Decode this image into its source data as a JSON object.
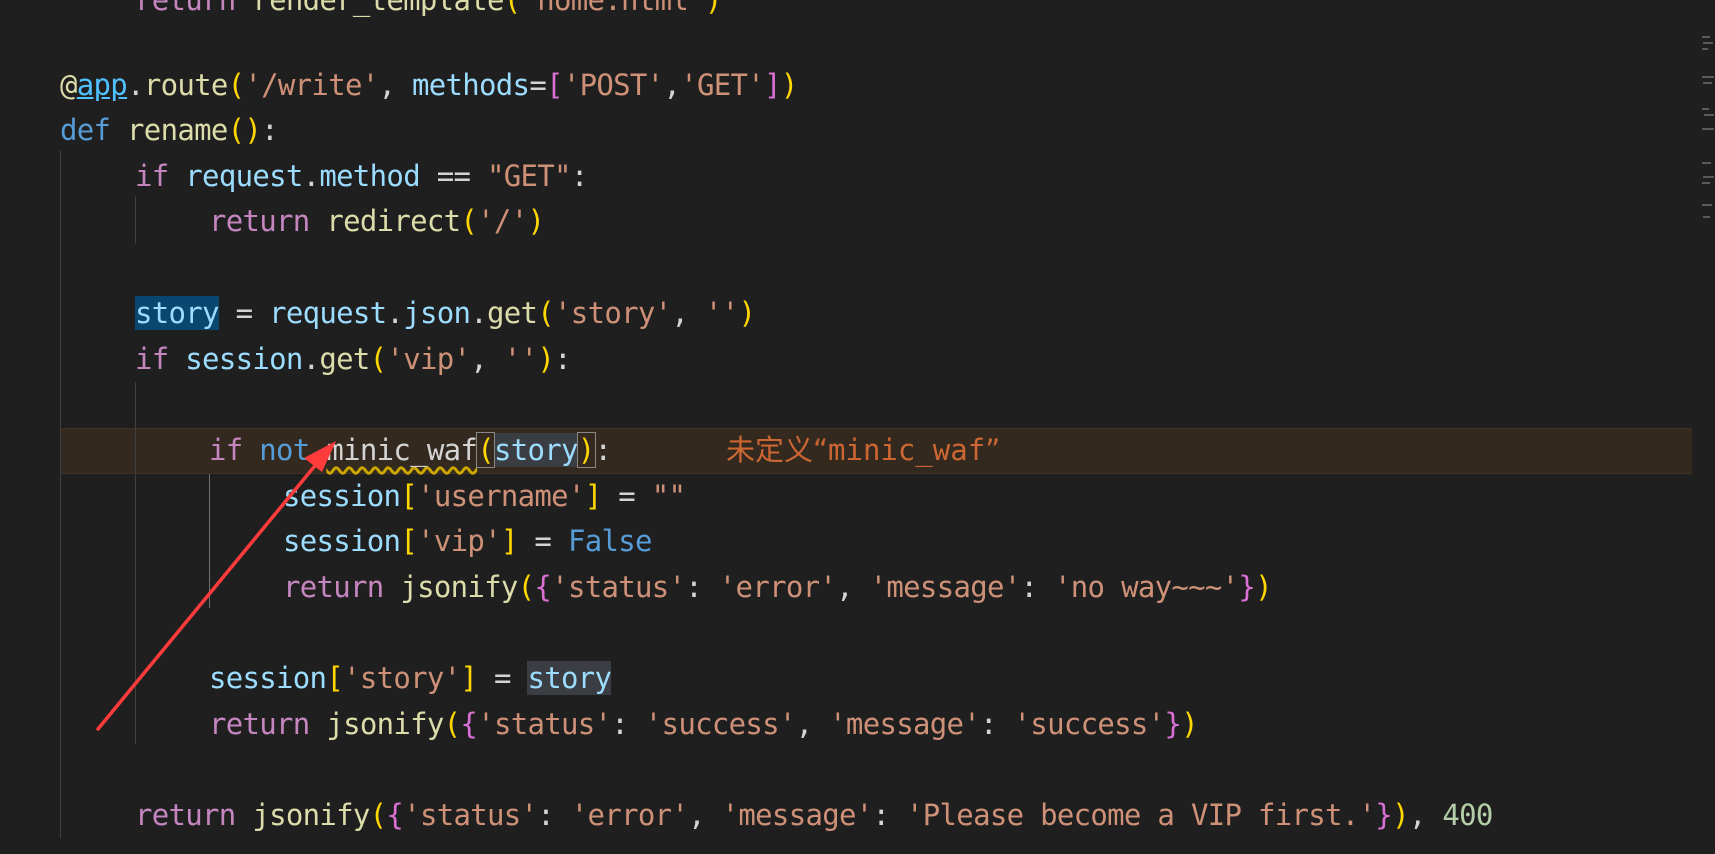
{
  "editor": {
    "language": "python",
    "lines": {
      "l0": {
        "kw": "return",
        "fn": "render_template",
        "str": "'home.html'"
      },
      "l1": {
        "dec": "@",
        "app": "app",
        "route": "route",
        "str1": "'/write'",
        "methods": "methods",
        "s_post": "'POST'",
        "s_get": "'GET'"
      },
      "l2": {
        "def": "def",
        "name": "rename"
      },
      "l3": {
        "kw": "if",
        "request": "request",
        "method": "method",
        "str": "\"GET\""
      },
      "l4": {
        "kw": "return",
        "fn": "redirect",
        "str": "'/'"
      },
      "l5": {
        "var": "story",
        "request": "request",
        "json": "json",
        "get": "get",
        "s1": "'story'",
        "s2": "''"
      },
      "l6": {
        "kw": "if",
        "session": "session",
        "get": "get",
        "s1": "'vip'",
        "s2": "''"
      },
      "l7": {
        "kw1": "if",
        "kw2": "not",
        "fn": "minic_waf",
        "arg": "story"
      },
      "l8": {
        "session": "session",
        "key": "'username'",
        "val": "\"\""
      },
      "l9": {
        "session": "session",
        "key": "'vip'",
        "val": "False"
      },
      "l10": {
        "kw": "return",
        "fn": "jsonify",
        "k1": "'status'",
        "v1": "'error'",
        "k2": "'message'",
        "v2": "'no way~~~'"
      },
      "l11": {
        "session": "session",
        "key": "'story'",
        "val": "story"
      },
      "l12": {
        "kw": "return",
        "fn": "jsonify",
        "k1": "'status'",
        "v1": "'success'",
        "k2": "'message'",
        "v2": "'success'"
      },
      "l13": {
        "kw": "return",
        "fn": "jsonify",
        "k1": "'status'",
        "v1": "'error'",
        "k2": "'message'",
        "v2": "'Please become a VIP first.'",
        "num": "400"
      }
    },
    "inline_error": {
      "prefix": "未定义",
      "quote_open": "“",
      "name": "minic_waf",
      "quote_close": "”"
    }
  },
  "annotation": {
    "type": "arrow",
    "color": "#ff3b3b",
    "icon": "red-arrow-icon"
  },
  "colors": {
    "background": "#1f1f1f",
    "error_line": "#33291f",
    "keyword": "#c586c0",
    "string": "#ce9178",
    "function": "#dcdcaa",
    "variable": "#9cdcfe",
    "error_text": "#cc6633"
  }
}
